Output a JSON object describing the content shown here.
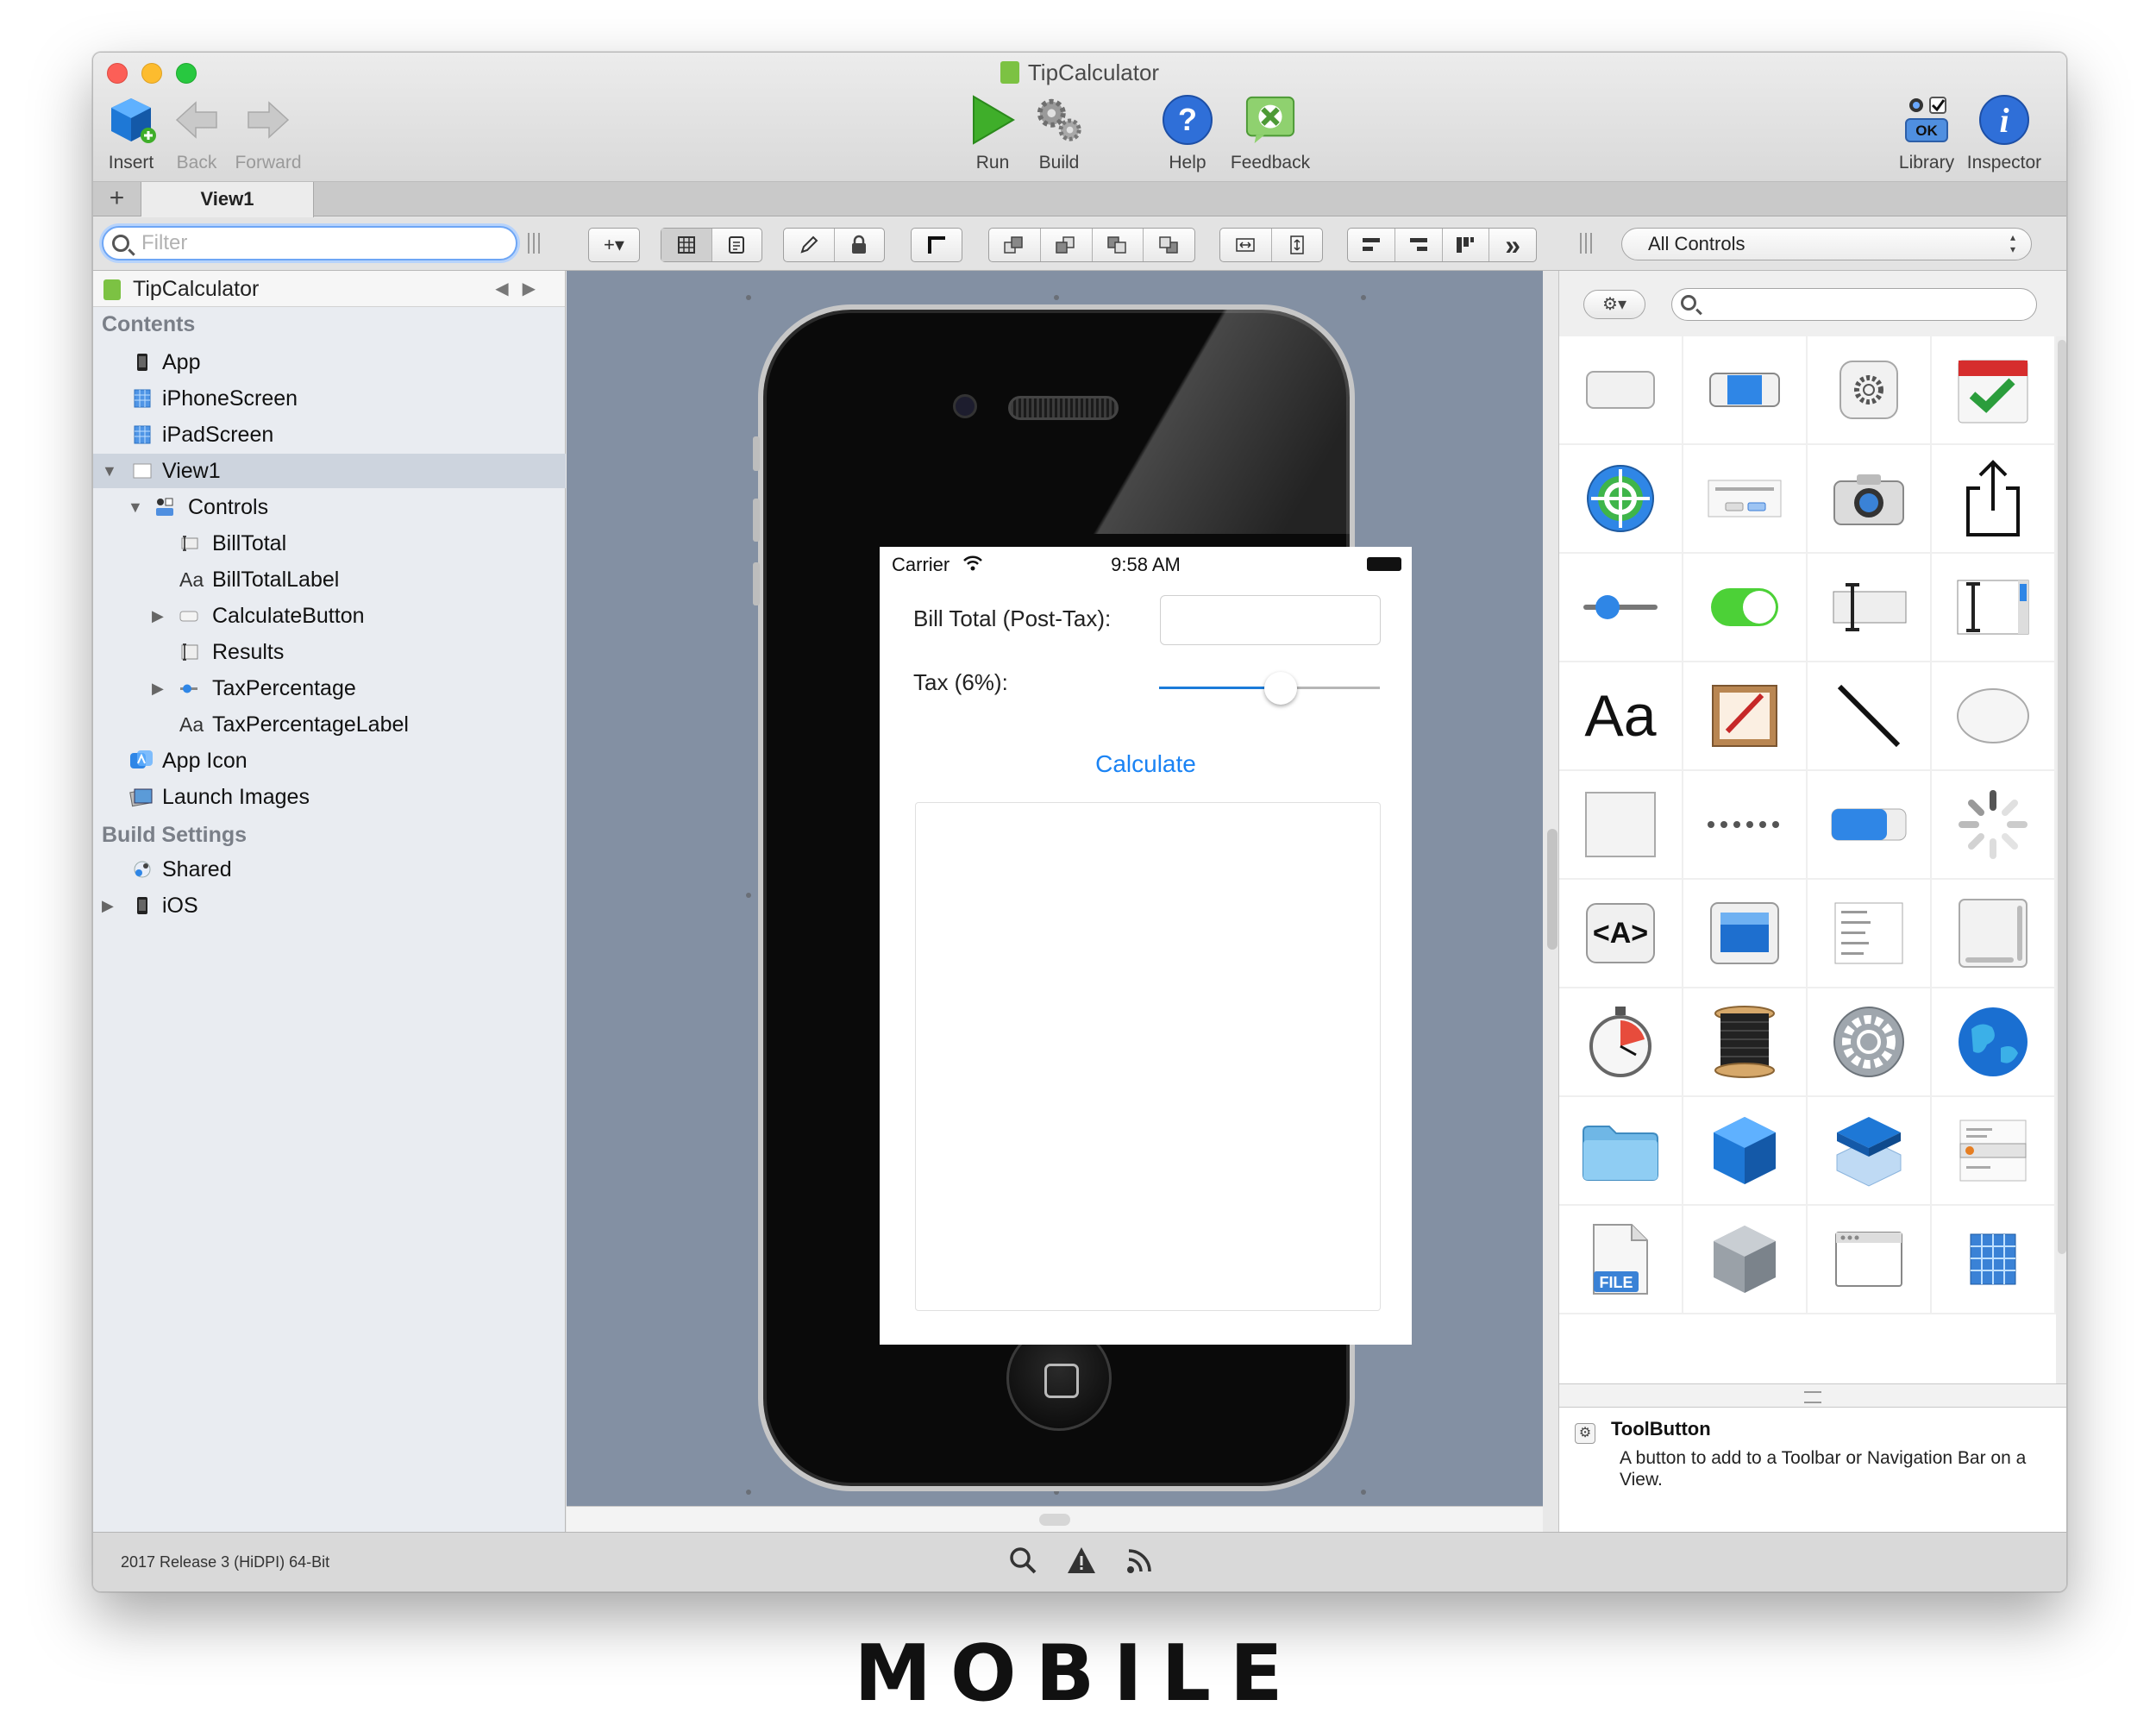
{
  "window": {
    "title": "TipCalculator"
  },
  "toolbar": {
    "insert": "Insert",
    "back": "Back",
    "forward": "Forward",
    "run": "Run",
    "build": "Build",
    "help": "Help",
    "feedback": "Feedback",
    "library": "Library",
    "inspector": "Inspector",
    "library_ok": "OK"
  },
  "tabs": {
    "plus": "+",
    "active": "View1"
  },
  "filter": {
    "placeholder": "Filter"
  },
  "layout_toolbar": {
    "more": "»",
    "controls_dropdown": "All Controls"
  },
  "navigator": {
    "project": "TipCalculator",
    "contents_header": "Contents",
    "build_header": "Build Settings",
    "items": [
      {
        "label": "App",
        "icon": "iphone-icon"
      },
      {
        "label": "iPhoneScreen",
        "icon": "screen-grid-icon"
      },
      {
        "label": "iPadScreen",
        "icon": "screen-grid-icon"
      },
      {
        "label": "View1",
        "icon": "view-icon"
      },
      {
        "label": "Controls",
        "icon": "controls-icon"
      },
      {
        "label": "BillTotal",
        "icon": "textfield-icon"
      },
      {
        "label": "BillTotalLabel",
        "icon": "label-icon"
      },
      {
        "label": "CalculateButton",
        "icon": "button-icon"
      },
      {
        "label": "Results",
        "icon": "textarea-icon"
      },
      {
        "label": "TaxPercentage",
        "icon": "slider-icon"
      },
      {
        "label": "TaxPercentageLabel",
        "icon": "label-icon"
      },
      {
        "label": "App Icon",
        "icon": "app-icon-icon"
      },
      {
        "label": "Launch Images",
        "icon": "launch-images-icon"
      },
      {
        "label": "Shared",
        "icon": "shared-icon"
      },
      {
        "label": "iOS",
        "icon": "iphone-icon"
      }
    ],
    "label_glyph": "Aa"
  },
  "mobile_screen": {
    "carrier": "Carrier",
    "time": "9:58 AM",
    "bill_label": "Bill Total (Post-Tax):",
    "tax_label": "Tax (6%):",
    "slider_value": 0.55,
    "calculate": "Calculate"
  },
  "library": {
    "gear": "⚙▾",
    "icons": [
      "push-button-icon",
      "segmented-control-icon",
      "settings-icon",
      "calendar-checkmark-icon",
      "location-target-icon",
      "alert-dialog-icon",
      "camera-icon",
      "share-icon",
      "slider-icon",
      "toggle-switch-icon",
      "text-field-icon",
      "text-area-icon",
      "label-icon",
      "canvas-icon",
      "line-icon",
      "oval-icon",
      "rectangle-icon",
      "page-control-icon",
      "progress-bar-icon",
      "activity-spinner-icon",
      "html-viewer-icon",
      "image-viewer-icon",
      "table-icon",
      "scroller-icon",
      "timer-icon",
      "thread-spool-icon",
      "worker-gear-icon",
      "globe-icon",
      "folder-icon",
      "module-cube-icon",
      "container-icon",
      "picker-icon",
      "file-icon",
      "class-icon",
      "window-icon",
      "grid-icon"
    ],
    "cell_text": {
      "label": "Aa",
      "html": "<A>",
      "file": "FILE"
    },
    "selected_name": "ToolButton",
    "selected_desc": "A button to add to a Toolbar or Navigation Bar on a View."
  },
  "statusbar": {
    "version": "2017 Release 3 (HiDPI) 64-Bit"
  },
  "caption": "MOBILE",
  "colors": {
    "canvas": "#8390a3",
    "accent": "#1a83f4",
    "run_green": "#3fae2a",
    "help_blue": "#2f6fd8"
  }
}
